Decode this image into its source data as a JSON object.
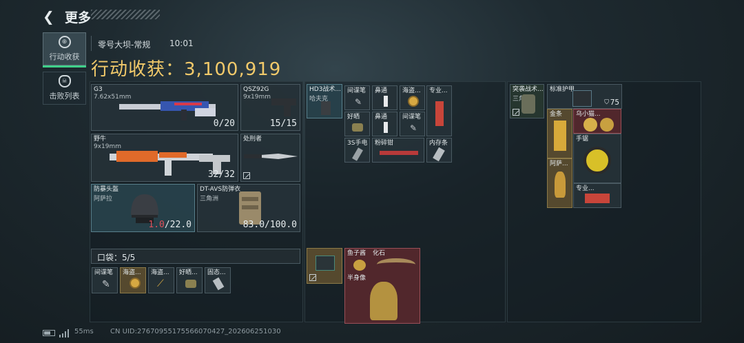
{
  "header": {
    "back_glyph": "❮",
    "title": "更多"
  },
  "tabs": [
    {
      "label": "行动收获",
      "active": true
    },
    {
      "label": "击败列表",
      "active": false
    }
  ],
  "match": {
    "map": "零号大坝-常规",
    "time": "10:01"
  },
  "haul": {
    "label": "行动收获：",
    "value": "3,100,919"
  },
  "loadout": {
    "g3": {
      "name": "G3",
      "sub": "7.62x51mm",
      "count": "0/20"
    },
    "qsz": {
      "name": "QSZ92G",
      "sub": "9x19mm",
      "count": "15/15"
    },
    "yeniu": {
      "name": "野牛",
      "sub": "9x19mm",
      "count": "32/32"
    },
    "knife": {
      "name": "处刑者"
    },
    "helmet": {
      "name": "防暴头盔",
      "sub": "阿萨拉",
      "dur_current": "1.0",
      "dur_max": "/22.0"
    },
    "armor": {
      "name": "DT-AVS防弹衣",
      "sub": "三角洲",
      "dur": "83.0/100.0"
    }
  },
  "pocket": {
    "label": "口袋：5/5",
    "items": [
      "间谍笔",
      "海盗...",
      "海盗...",
      "好晒...",
      "固态..."
    ]
  },
  "rig": {
    "name": "HD3战术...",
    "sub": "哈夫克",
    "items": [
      "间谍笔",
      "鼻通",
      "海盗...",
      "专业...",
      "好晒",
      "鼻通",
      "间谍笔",
      "3S手电",
      "粉碎钳",
      "内存条"
    ]
  },
  "bag1": {
    "items": [
      "鱼子酱",
      "化石",
      "半身像"
    ]
  },
  "backpack": {
    "name": "突袭战术...",
    "sub": "三角洲",
    "armor_label": "标准护甲",
    "armor_value": "75",
    "items": [
      "金条",
      "乌小猫...",
      "手锯",
      "阿萨...",
      "专业..."
    ]
  },
  "status": {
    "ping": "55ms",
    "uid": "CN UID:2767095517556607042​7_20260625103​0"
  },
  "colors": {
    "accent": "#3fd08a",
    "haul_gold": "#f1c96a",
    "warn_red": "#e0505a"
  }
}
